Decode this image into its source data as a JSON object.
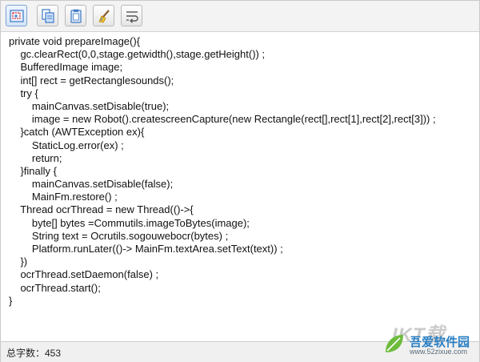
{
  "toolbar": {
    "buttons": [
      {
        "icon": "screenshot-capture-icon"
      },
      {
        "icon": "copy-document-icon"
      },
      {
        "icon": "paste-clipboard-icon"
      },
      {
        "icon": "clear-brush-icon"
      },
      {
        "icon": "word-wrap-icon"
      }
    ]
  },
  "editor": {
    "lines": [
      "private void prepareImage(){",
      "    gc.clearRect(0,0,stage.getwidth(),stage.getHeight()) ;",
      "    BufferedImage image;",
      "    int[] rect = getRectanglesounds();",
      "    try {",
      "        mainCanvas.setDisable(true);",
      "        image = new Robot().createscreenCapture(new Rectangle(rect[],rect[1],rect[2],rect[3])) ;",
      "    }catch (AWTException ex){",
      "        StaticLog.error(ex) ;",
      "        return;",
      "    }finally {",
      "        mainCanvas.setDisable(false);",
      "        MainFm.restore() ;",
      "    Thread ocrThread = new Thread(()->{",
      "        byte[] bytes =Commutils.imageToBytes(image);",
      "        String text = Ocrutils.sogouwebocr(bytes) ;",
      "        Platform.runLater(()-> MainFm.textArea.setText(text)) ;",
      "    })",
      "    ocrThread.setDaemon(false) ;",
      "    ocrThread.start();",
      "}"
    ]
  },
  "status": {
    "char_count_label": "总字数：453"
  },
  "watermark": {
    "big_text": "IKT载",
    "site_name": "吾爱软件园",
    "url": "www.52zixue.com"
  }
}
